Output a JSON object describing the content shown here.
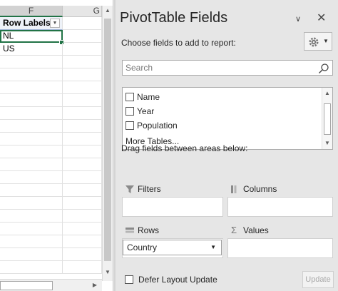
{
  "sheet": {
    "columns": [
      "F",
      "G"
    ],
    "header_cell": "Row Labels",
    "rows": [
      "NL",
      "US"
    ]
  },
  "pane": {
    "title": "PivotTable Fields",
    "choose_label": "Choose fields to add to report:",
    "search_placeholder": "Search",
    "fields": [
      {
        "label": "Name",
        "checked": false
      },
      {
        "label": "Year",
        "checked": false
      },
      {
        "label": "Population",
        "checked": false
      }
    ],
    "more_tables": "More Tables...",
    "drag_label": "Drag fields between areas below:",
    "areas": {
      "filters": "Filters",
      "columns": "Columns",
      "rows": "Rows",
      "values": "Values"
    },
    "row_field": "Country",
    "defer_label": "Defer Layout Update",
    "update_label": "Update"
  },
  "icons": {
    "dropdown": "chevron-down-icon",
    "close": "close-icon",
    "settings": "gear-icon",
    "search": "search-icon"
  }
}
